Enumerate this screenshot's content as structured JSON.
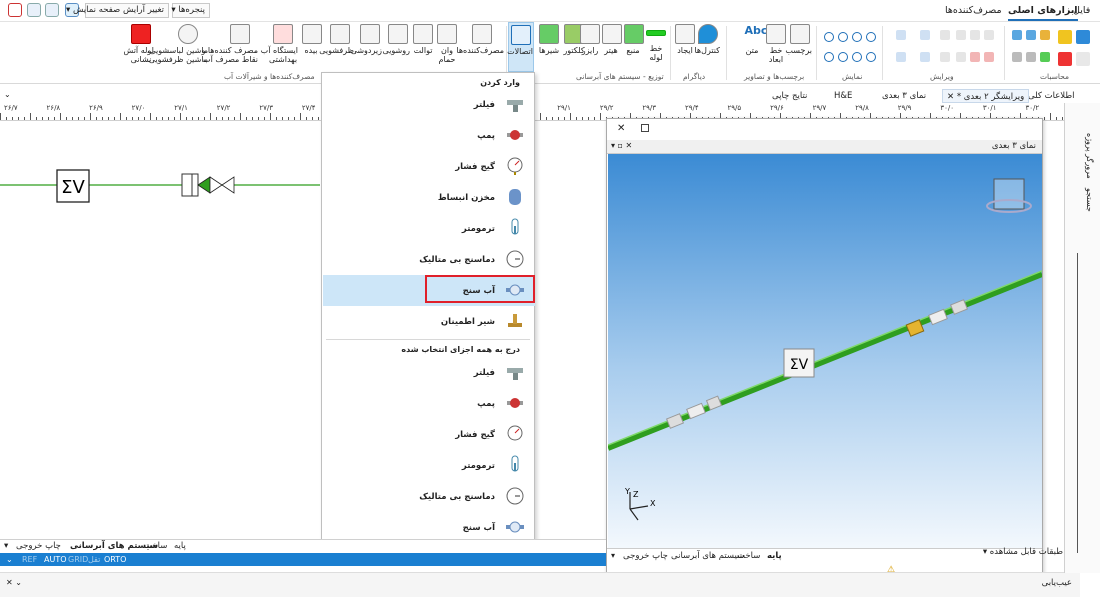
{
  "quick_access": {
    "windows_label": "پنجره‌ها",
    "change_layout_label": "تغییر آرایش صفحه نمایش"
  },
  "ribbon_tabs": {
    "file": "فایل",
    "main_tools": "ابزارهای اصلی",
    "consumers": "مصرف‌کننده‌ها"
  },
  "ribbon_tools": [
    {
      "label": "لوله آتش\nنشانی",
      "name": "fire-pipe"
    },
    {
      "label": "ماشین لباسشویی،\nماشین ظرفشویی",
      "name": "washing-machine"
    },
    {
      "label": "مصرف کننده‌ها و\nنقاط مصرف آب",
      "name": "consumer-points"
    },
    {
      "label": "ایستگاه آب\nبهداشتی",
      "name": "water-station"
    },
    {
      "label": "بیده",
      "name": "bidet"
    },
    {
      "label": "ظرفشویی",
      "name": "sink"
    },
    {
      "label": "زیردوشی",
      "name": "shower"
    },
    {
      "label": "روشویی",
      "name": "washbasin"
    },
    {
      "label": "توالت",
      "name": "toilet"
    },
    {
      "label": "وان\nحمام",
      "name": "bathtub"
    },
    {
      "label": "مصرف‌کننده‌ها",
      "name": "consumers"
    },
    {
      "label": "اتصالات",
      "name": "fittings"
    },
    {
      "label": "شیرها",
      "name": "valves"
    },
    {
      "label": "کلکتور",
      "name": "collector"
    },
    {
      "label": "رایزر",
      "name": "riser"
    },
    {
      "label": "هیتر",
      "name": "heater"
    },
    {
      "label": "منبع",
      "name": "tank"
    },
    {
      "label": "خط\nلوله",
      "name": "pipeline"
    },
    {
      "label": "ایجاد",
      "name": "create"
    },
    {
      "label": "کنترل‌ها",
      "name": "controls"
    },
    {
      "label": "متن",
      "name": "text"
    },
    {
      "label": "خط\nابعاد",
      "name": "dimension-line"
    },
    {
      "label": "برچسب",
      "name": "label"
    }
  ],
  "ribbon_groups": {
    "consumers_group": "مصرف‌کننده‌ها و شیرآلات آب",
    "distribution": "توزیع - سیستم های آبرسانی",
    "diagram": "دیاگرام",
    "labels_images": "برچسب‌ها و تصاویر",
    "display": "نمایش",
    "edit": "ویرایش",
    "calculations": "محاسبات"
  },
  "doc_tabs": [
    {
      "label": "اطلاعات کلی"
    },
    {
      "label": "ویرایشگر ۲ بعدی *"
    },
    {
      "label": "نمای ۳ بعدی"
    },
    {
      "label": "H&E"
    },
    {
      "label": "نتایج چاپی"
    }
  ],
  "ruler_labels": [
    "۲۶/۷",
    "۲۶/۸",
    "۲۶/۹",
    "۲۷/۰",
    "۲۷/۱",
    "۲۷/۲",
    "۲۷/۳",
    "۲۷/۴",
    "۲۷/۵",
    "۲۸/۶",
    "۲۸/۷",
    "۲۸/۸",
    "۲۹/۰",
    "۲۹/۱",
    "۲۹/۲",
    "۲۹/۳",
    "۲۹/۴",
    "۲۹/۵",
    "۲۹/۶",
    "۲۹/۷",
    "۲۹/۸",
    "۲۹/۹",
    "۳۰/۰",
    "۳۰/۱",
    "۳۰/۲"
  ],
  "menu": {
    "section1": "وارد کردن",
    "section2": "درج به همه اجزای انتخاب شده",
    "items1": [
      "فیلتر",
      "پمپ",
      "گیج فشار",
      "مخزن انبساط",
      "ترمومتر",
      "دماسنج بی متالیک",
      "آب سنج",
      "شیر اطمینان"
    ],
    "items2": [
      "فیلتر",
      "پمپ",
      "گیج فشار",
      "ترمومتر",
      "دماسنج بی متالیک",
      "آب سنج"
    ]
  },
  "view3d": {
    "title": "نمای ۳ بعدی",
    "symbol": "ΣV",
    "axis_x": "X",
    "axis_y": "Y",
    "axis_z": "Z"
  },
  "canvas_symbol": "ΣV",
  "sheet_tabs": {
    "base": "پایه",
    "build": "ساخت",
    "water_systems": "سیستم های آبرسانی",
    "print_output": "چاپ خروجی"
  },
  "statusbar": {
    "auto": "AUTO",
    "grid": "GRID",
    "ortho": "ORTO",
    "pref": "REF",
    "snap": "تقل"
  },
  "view3d_bottom": {
    "layers": "طبقات قابل مشاهده",
    "base": "پایه",
    "build": "ساخت",
    "water_systems": "سیستم های آبرسانی",
    "print_output": "چاپ خروجی"
  },
  "side_panel": {
    "project_explorer": "مرورگر پروژه",
    "search": "جستجو"
  },
  "bottom_right": {
    "troubleshoot": "عیب‌یابی"
  },
  "colors": {
    "accent": "#1a7fd1",
    "pipe_green": "#2f9e1f",
    "highlight": "#cde6f8",
    "red_box": "#e0202a"
  }
}
